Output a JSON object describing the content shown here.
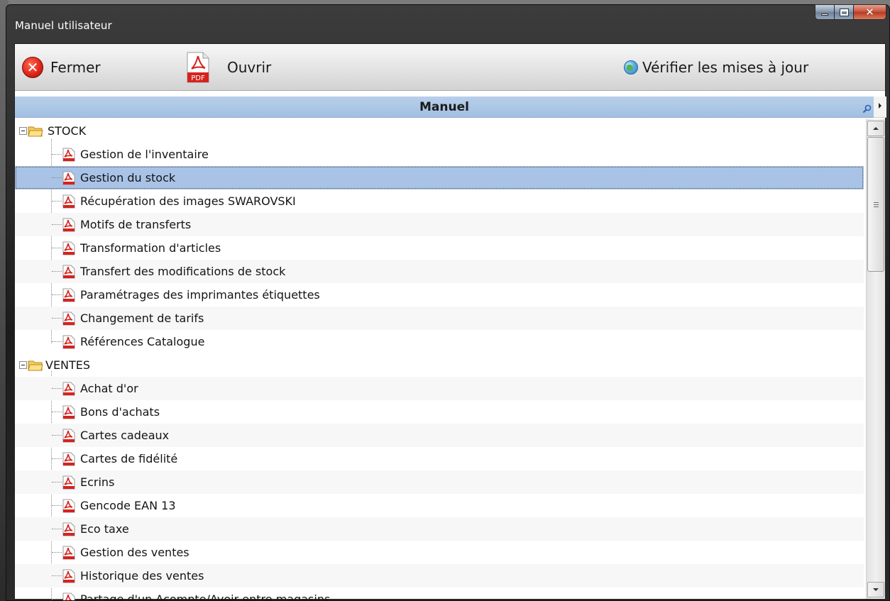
{
  "window": {
    "title": "Manuel utilisateur"
  },
  "toolbar": {
    "close_label": "Fermer",
    "close_icon": "close-icon",
    "open_label": "Ouvrir",
    "open_icon": "pdf-icon",
    "pdf_badge": "PDF",
    "update_label": "Vérifier les mises à jour",
    "update_icon": "globe-icon"
  },
  "tree_header": {
    "title": "Manuel"
  },
  "tree": {
    "groups": [
      {
        "label": "STOCK",
        "expanded": true,
        "items": [
          "Gestion de l'inventaire",
          "Gestion du stock",
          "Récupération des images SWAROVSKI",
          "Motifs de transferts",
          "Transformation d'articles",
          "Transfert des modifications de stock",
          "Paramétrages des imprimantes étiquettes",
          "Changement de tarifs",
          "Références Catalogue"
        ]
      },
      {
        "label": "VENTES",
        "expanded": true,
        "items": [
          "Achat d'or",
          "Bons d'achats",
          "Cartes cadeaux",
          "Cartes de fidélité",
          "Ecrins",
          "Gencode EAN 13",
          "Eco taxe",
          "Gestion des ventes",
          "Historique des ventes",
          "Partage d'un Acompte/Avoir entre magasins"
        ]
      }
    ],
    "selected_item": "Gestion du stock"
  },
  "colors": {
    "selection": "#a9c3e6",
    "header": "#a2bfe2",
    "title_bar": "#1c1c1c"
  }
}
